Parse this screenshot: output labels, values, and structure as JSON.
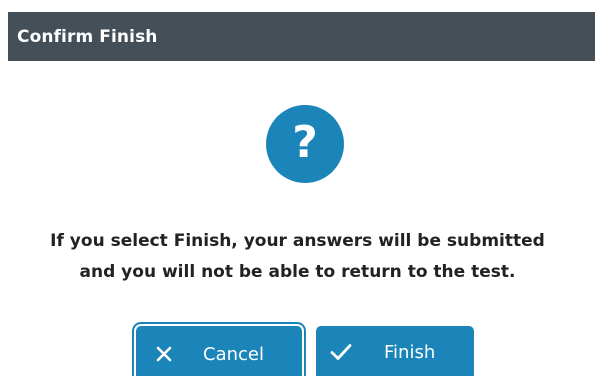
{
  "dialog": {
    "title": "Confirm Finish",
    "icon": "question-mark-icon",
    "icon_glyph": "?",
    "message_lines": [
      "If you select Finish, your answers will be submitted",
      "and you will not be able to return to the test."
    ]
  },
  "buttons": {
    "cancel": {
      "label": "Cancel",
      "icon": "close-icon"
    },
    "finish": {
      "label": "Finish",
      "icon": "checkmark-icon"
    }
  },
  "colors": {
    "titlebar": "#444f58",
    "accent": "#1b84b8",
    "text": "#222222"
  }
}
